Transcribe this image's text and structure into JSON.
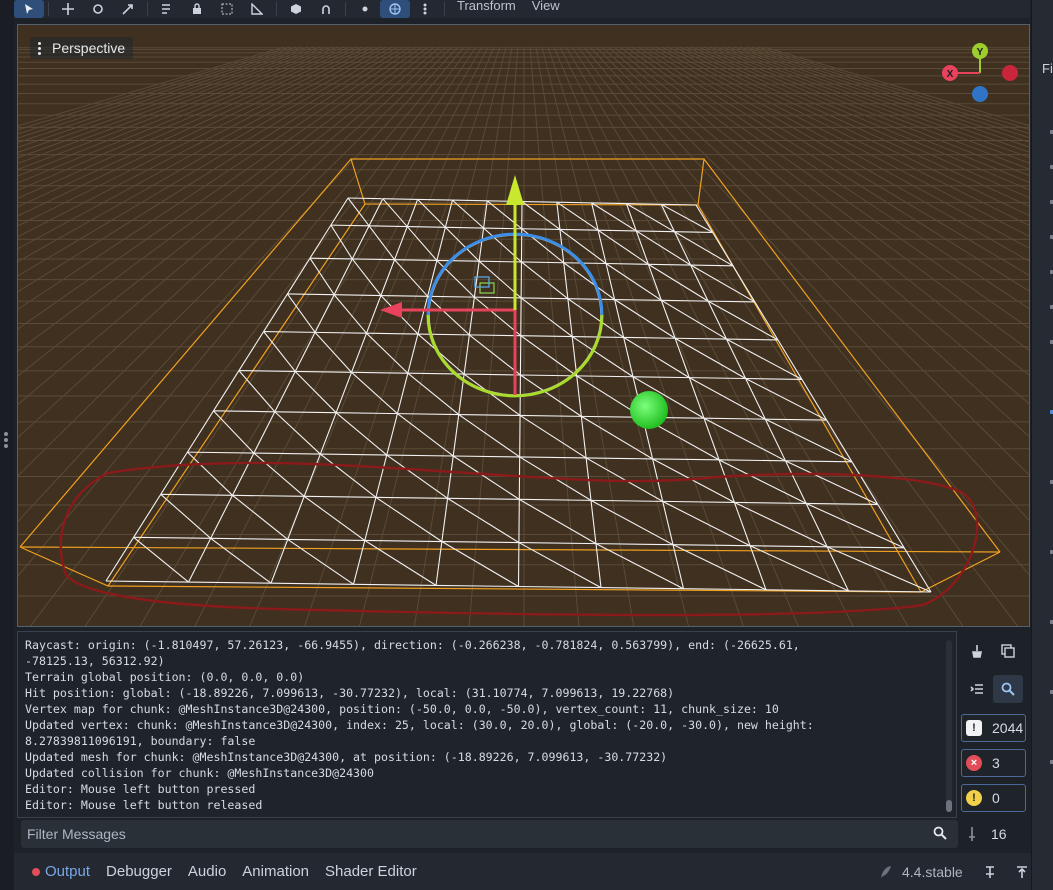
{
  "toolbar": {
    "menus": [
      "Transform",
      "View"
    ],
    "icons": [
      "select-icon",
      "move-icon",
      "rotate-icon",
      "scale-icon",
      "list-select-icon",
      "lock-icon",
      "group-icon",
      "ruler-icon",
      "cube-icon",
      "snap-icon",
      "sun-icon",
      "globe-icon",
      "more-icon"
    ]
  },
  "viewport": {
    "menu_label": "Perspective",
    "gizmo": {
      "x": "X",
      "y": "Y"
    }
  },
  "right_panel": {
    "tab_label": "Fi"
  },
  "output": {
    "log": [
      "Raycast: origin: (-1.810497, 57.26123, -66.9455), direction: (-0.266238, -0.781824, 0.563799), end: (-26625.61,",
      "-78125.13, 56312.92)",
      "Terrain global position: (0.0, 0.0, 0.0)",
      "Hit position: global: (-18.89226, 7.099613, -30.77232), local: (31.10774, 7.099613, 19.22768)",
      "Vertex map for chunk: @MeshInstance3D@24300, position: (-50.0, 0.0, -50.0), vertex_count: 11, chunk_size: 10",
      "Updated vertex: chunk: @MeshInstance3D@24300, index: 25, local: (30.0, 20.0), global: (-20.0, -30.0), new height:",
      "8.27839811096191, boundary: false",
      "Updated mesh for chunk: @MeshInstance3D@24300, at position: (-18.89226, 7.099613, -30.77232)",
      "Updated collision for chunk: @MeshInstance3D@24300",
      "Editor: Mouse left button pressed",
      "Editor: Mouse left button released"
    ],
    "filter_placeholder": "Filter Messages",
    "counts": {
      "messages": "2044",
      "errors": "3",
      "warnings": "0",
      "line_count": "16"
    }
  },
  "bottom_tabs": [
    "Output",
    "Debugger",
    "Audio",
    "Animation",
    "Shader Editor"
  ],
  "version": "4.4.stable",
  "colors": {
    "accent": "#4d8fe6",
    "viewport_bg": "#3f3020",
    "error": "#e34d59",
    "warning": "#f2d14a",
    "gizmo_x": "#e8435c",
    "gizmo_y": "#a8dc2a",
    "gizmo_z": "#3a8ee8",
    "selection": "#f0a020",
    "annotation": "#8b1a1a",
    "sphere": "#3ae83a"
  }
}
